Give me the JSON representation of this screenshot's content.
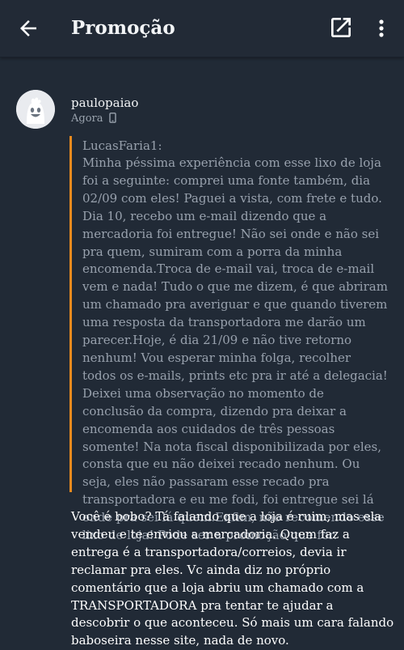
{
  "appbar": {
    "title": "Promoção",
    "back_icon": "arrow-left-icon",
    "open_icon": "open-in-new-icon",
    "more_icon": "more-vert-icon"
  },
  "comment": {
    "author": "paulopaiao",
    "time": "Agora",
    "device_icon": "phone-icon",
    "quote_author": "LucasFaria1:",
    "quote_text": "Minha péssima experiência com esse lixo de loja foi a seguinte: comprei uma fonte também, dia 02/09 com eles! Paguei a vista, com frete e tudo. Dia 10, recebo um e-mail dizendo que a mercadoria foi entregue! Não sei onde e não sei pra quem, sumiram com a porra da minha encomenda.Troca de e-mail vai, troca de e-mail vem e nada! Tudo o que me dizem, é que abriram um chamado pra averiguar e que quando tiverem uma resposta da transportadora me darão um parecer.Hoje, é dia 21/09 e não tive retorno nenhum! Vou esperar minha folga, recolher todos os e-mails, prints etc pra ir até a delegacia! Deixei uma observação no momento de conclusão da compra, dizendo pra deixar a encomenda aos cuidados de três pessoas somente! Na nota fiscal disponibilizada por eles, consta que eu não deixei recado nenhum. Ou seja, eles não passaram esse recado pra transportadora e eu me fodi, foi entregue sei lá onde pra sei lá quem.Enfim, não recomendo esse lixo de loja! Pode ser a promoção que for.",
    "reply_text": "Você é bobo? Tá falando que a loja é ruim, mas ela vendeu e te enviou a mercadoria. Quem faz a entrega é a transportadora/correios, devia ir reclamar pra eles. Vc ainda diz no próprio comentário que a loja abriu um chamado com a TRANSPORTADORA pra tentar te ajudar a descobrir o que aconteceu. Só mais um cara falando baboseira nesse site, nada de novo."
  },
  "colors": {
    "background": "#212a36",
    "quote_border": "#e88a1e",
    "quote_text": "#98a1ad"
  }
}
